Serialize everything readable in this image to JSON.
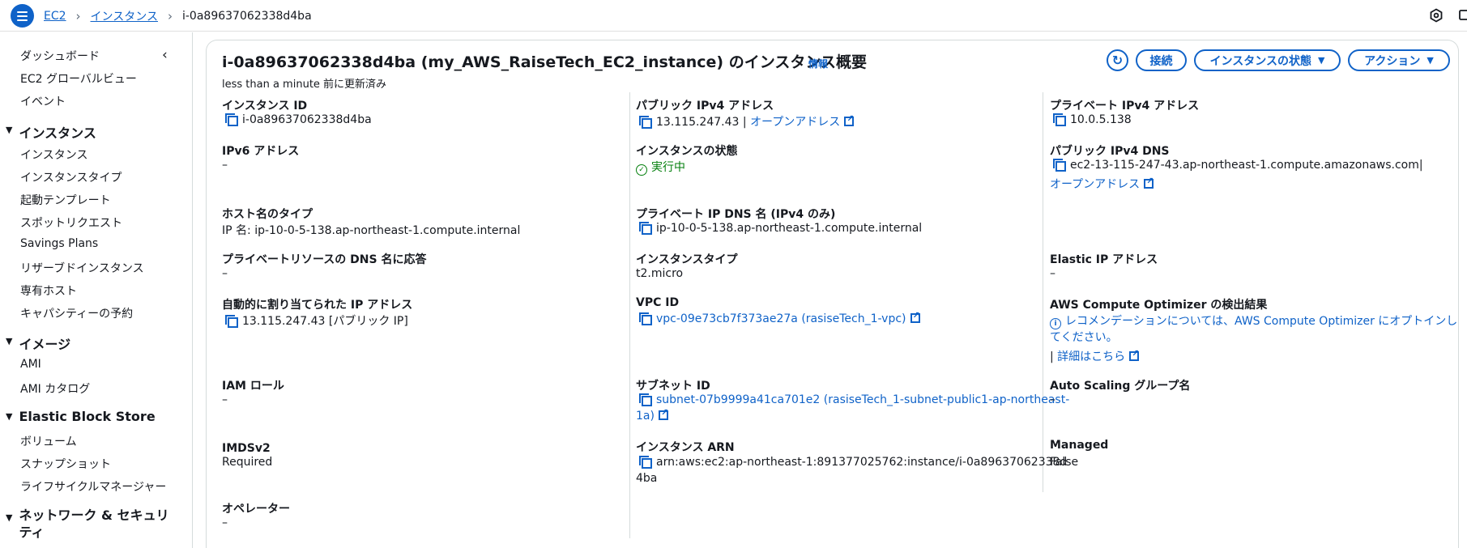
{
  "breadcrumb": {
    "root": "EC2",
    "section": "インスタンス",
    "current": "i-0a89637062338d4ba"
  },
  "icons": {
    "menu": "hamburger-menu-icon",
    "collapse": "chevron-left-icon",
    "settings": "hexagon-settings-icon",
    "notifications": "notification-icon",
    "refresh": "refresh-icon",
    "copy": "copy-icon",
    "external": "external-link-icon",
    "status_ok": "check-circle-icon",
    "info": "info-circle-icon"
  },
  "sidebar": {
    "items_top": [
      "ダッシュボード",
      "EC2 グローバルビュー",
      "イベント"
    ],
    "instances_title": "インスタンス",
    "instances_items": [
      "インスタンス",
      "インスタンスタイプ",
      "起動テンプレート",
      "スポットリクエスト",
      "Savings Plans",
      "リザーブドインスタンス",
      "専有ホスト",
      "キャパシティーの予約"
    ],
    "images_title": "イメージ",
    "images_items": [
      "AMI",
      "AMI カタログ"
    ],
    "ebs_title": "Elastic Block Store",
    "ebs_items": [
      "ボリューム",
      "スナップショット",
      "ライフサイクルマネージャー"
    ],
    "network_title_line1": "ネットワーク & セキュリ",
    "network_title_line2": "ティ"
  },
  "header": {
    "title": "i-0a89637062338d4ba (my_AWS_RaiseTech_EC2_instance) のインスタンス概要",
    "info": "情報",
    "subtitle": "less than a minute 前に更新済み",
    "connect_label": "接続",
    "state_label": "インスタンスの状態",
    "actions_label": "アクション"
  },
  "details": {
    "instance_id_label": "インスタンス ID",
    "instance_id": "i-0a89637062338d4ba",
    "ipv6_label": "IPv6 アドレス",
    "ipv6": "–",
    "hostname_type_label": "ホスト名のタイプ",
    "hostname_type": "IP 名: ip-10-0-5-138.ap-northeast-1.compute.internal",
    "private_dns_resp_label": "プライベートリソースの DNS 名に応答",
    "private_dns_resp": "–",
    "auto_ip_label": "自動的に割り当てられた IP アドレス",
    "auto_ip": "13.115.247.43 [パブリック IP]",
    "iam_role_label": "IAM ロール",
    "iam_role": "–",
    "imdsv2_label": "IMDSv2",
    "imdsv2": "Required",
    "operator_label": "オペレーター",
    "operator": "–",
    "public_ipv4_label": "パブリック IPv4 アドレス",
    "public_ipv4": "13.115.247.43",
    "open_address": "オープンアドレス",
    "state_label": "インスタンスの状態",
    "state": "実行中",
    "private_ip_dns_label": "プライベート IP DNS 名 (IPv4 のみ)",
    "private_ip_dns": "ip-10-0-5-138.ap-northeast-1.compute.internal",
    "instance_type_label": "インスタンスタイプ",
    "instance_type": "t2.micro",
    "vpc_id_label": "VPC ID",
    "vpc_id": "vpc-09e73cb7f373ae27a (rasiseTech_1-vpc)",
    "subnet_id_label": "サブネット ID",
    "subnet_id_line1": "subnet-07b9999a41ca701e2 (rasiseTech_1-subnet-public1-ap-northeast-",
    "subnet_id_line2": "1a)",
    "arn_label": "インスタンス ARN",
    "arn_line1": "arn:aws:ec2:ap-northeast-1:891377025762:instance/i-0a89637062338d",
    "arn_line2": "4ba",
    "private_ipv4_label": "プライベート IPv4 アドレス",
    "private_ipv4": "10.0.5.138",
    "public_dns_label": "パブリック IPv4 DNS",
    "public_dns": "ec2-13-115-247-43.ap-northeast-1.compute.amazonaws.com",
    "public_dns_sep": "|",
    "public_dns_open": "オープンアドレス",
    "eip_label": "Elastic IP アドレス",
    "eip": "–",
    "optimizer_label": "AWS Compute Optimizer の検出結果",
    "optimizer_line1": "レコメンデーションについては、AWS Compute Optimizer にオプトインし",
    "optimizer_line2": "てください。",
    "optimizer_sep": "|",
    "optimizer_more": "詳細はこちら",
    "asg_label": "Auto Scaling グループ名",
    "asg": "–",
    "managed_label": "Managed",
    "managed": "False"
  }
}
